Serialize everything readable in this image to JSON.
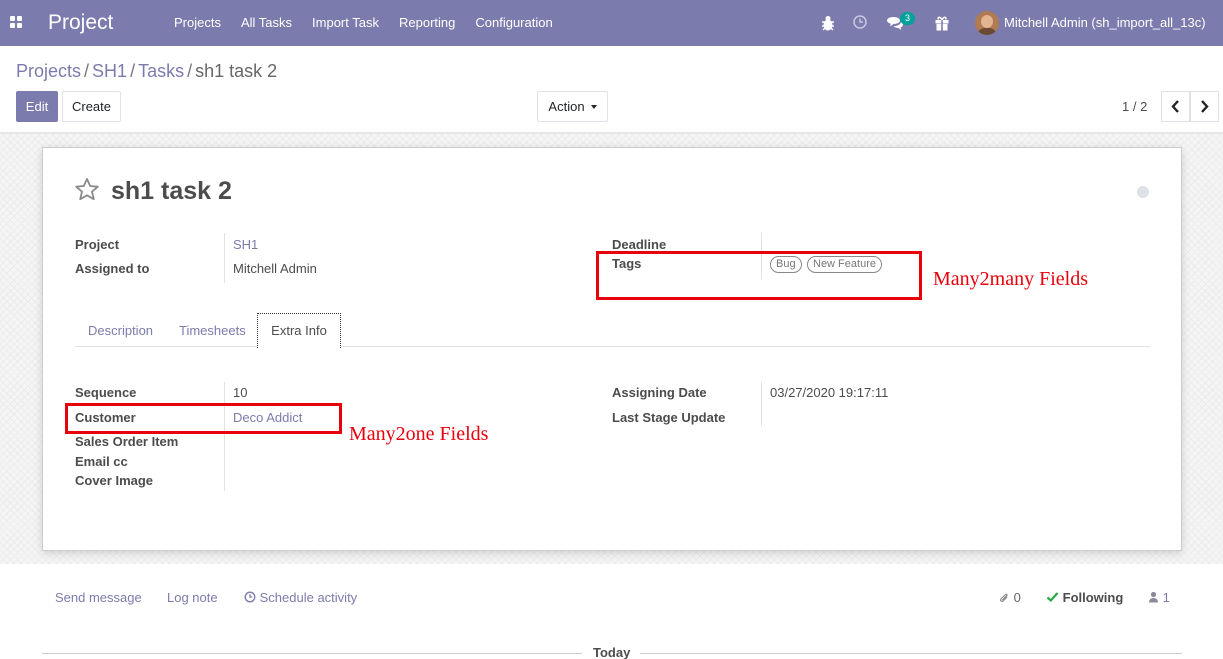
{
  "navbar": {
    "app_name": "Project",
    "menu": [
      "Projects",
      "All Tasks",
      "Import Task",
      "Reporting",
      "Configuration"
    ],
    "message_count": "3",
    "user": "Mitchell Admin (sh_import_all_13c)",
    "icons": [
      "apps-icon",
      "bug-icon",
      "clock-icon",
      "chat-icon",
      "gift-icon"
    ]
  },
  "breadcrumb": {
    "items": [
      "Projects",
      "SH1",
      "Tasks"
    ],
    "current": "sh1 task 2"
  },
  "controls": {
    "edit": "Edit",
    "create": "Create",
    "action": "Action",
    "pager": "1 / 2"
  },
  "record": {
    "title": "sh1 task 2",
    "project_label": "Project",
    "project": "SH1",
    "assigned_label": "Assigned to",
    "assigned": "Mitchell Admin",
    "deadline_label": "Deadline",
    "deadline": "",
    "tags_label": "Tags",
    "tags": [
      "Bug",
      "New Feature"
    ]
  },
  "tabs": [
    "Description",
    "Timesheets",
    "Extra Info"
  ],
  "extra_info": {
    "sequence_label": "Sequence",
    "sequence": "10",
    "customer_label": "Customer",
    "customer": "Deco Addict",
    "sales_order_label": "Sales Order Item",
    "email_cc_label": "Email cc",
    "cover_label": "Cover Image",
    "assigning_date_label": "Assigning Date",
    "assigning_date": "03/27/2020 19:17:11",
    "last_stage_label": "Last Stage Update"
  },
  "annotations": {
    "many2many": "Many2many Fields",
    "many2one": "Many2one Fields",
    "color": "#e8000b"
  },
  "chatter": {
    "send_message": "Send message",
    "log_note": "Log note",
    "schedule": "Schedule activity",
    "attachments": "0",
    "following": "Following",
    "followers": "1",
    "today": "Today"
  },
  "colors": {
    "brand": "#7c7bad",
    "following": "#28a745"
  }
}
